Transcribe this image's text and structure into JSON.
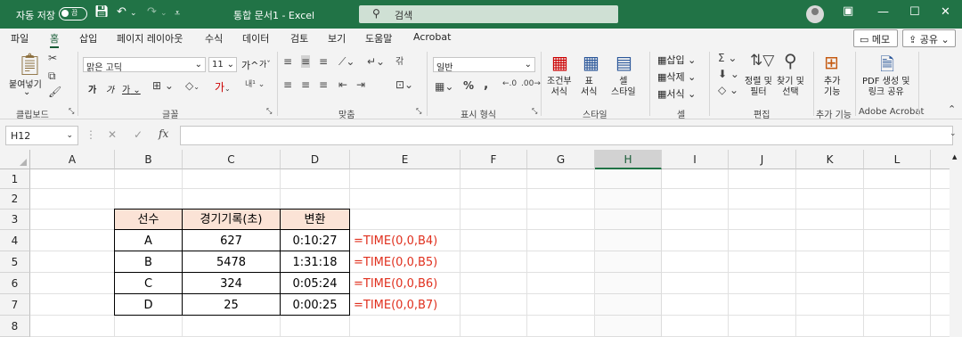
{
  "titlebar": {
    "autosave": "자동 저장",
    "autosave_state": "끔",
    "title": "통합 문서1  -  Excel",
    "search_placeholder": "검색"
  },
  "tabs": [
    "파일",
    "홈",
    "삽입",
    "페이지 레이아웃",
    "수식",
    "데이터",
    "검토",
    "보기",
    "도움말",
    "Acrobat"
  ],
  "active_tab": "홈",
  "top_buttons": {
    "memo": "메모",
    "share": "공유"
  },
  "ribbon": {
    "clipboard": {
      "paste": "붙여넣기",
      "label": "클립보드"
    },
    "font": {
      "name": "맑은 고딕",
      "size": "11",
      "grow": "가",
      "shrink": "가",
      "bold": "가",
      "italic": "가",
      "underline": "가",
      "label": "글꼴"
    },
    "alignment": {
      "label": "맞춤"
    },
    "number": {
      "format": "일반",
      "label": "표시 형식",
      "percent": "%",
      "comma": ","
    },
    "styles": {
      "conditional": "조건부\n서식",
      "table": "표\n서식",
      "cell": "셀\n스타일",
      "label": "스타일"
    },
    "cells": {
      "insert": "삽입",
      "delete": "삭제",
      "format": "서식",
      "label": "셀"
    },
    "editing": {
      "sort": "정렬 및\n필터",
      "find": "찾기 및\n선택",
      "label": "편집"
    },
    "addins": {
      "btn": "추가\n기능",
      "label": "추가 기능"
    },
    "acrobat": {
      "btn": "PDF 생성 및\n링크 공유",
      "label": "Adobe Acrobat"
    }
  },
  "namebox": "H12",
  "formula_bar": "",
  "columns": [
    "A",
    "B",
    "C",
    "D",
    "E",
    "F",
    "G",
    "H",
    "I",
    "J",
    "K",
    "L"
  ],
  "selected_column": "H",
  "rows": [
    "1",
    "2",
    "3",
    "4",
    "5",
    "6",
    "7",
    "8"
  ],
  "table": {
    "headers": [
      "선수",
      "경기기록(초)",
      "변환"
    ],
    "rows": [
      {
        "player": "A",
        "seconds": "627",
        "time": "0:10:27",
        "formula": "=TIME(0,0,B4)"
      },
      {
        "player": "B",
        "seconds": "5478",
        "time": "1:31:18",
        "formula": "=TIME(0,0,B5)"
      },
      {
        "player": "C",
        "seconds": "324",
        "time": "0:05:24",
        "formula": "=TIME(0,0,B6)"
      },
      {
        "player": "D",
        "seconds": "25",
        "time": "0:00:25",
        "formula": "=TIME(0,0,B7)"
      }
    ]
  },
  "colors": {
    "excel_green": "#217346",
    "header_fill": "#fbe3d6",
    "formula_red": "#e0301e"
  }
}
